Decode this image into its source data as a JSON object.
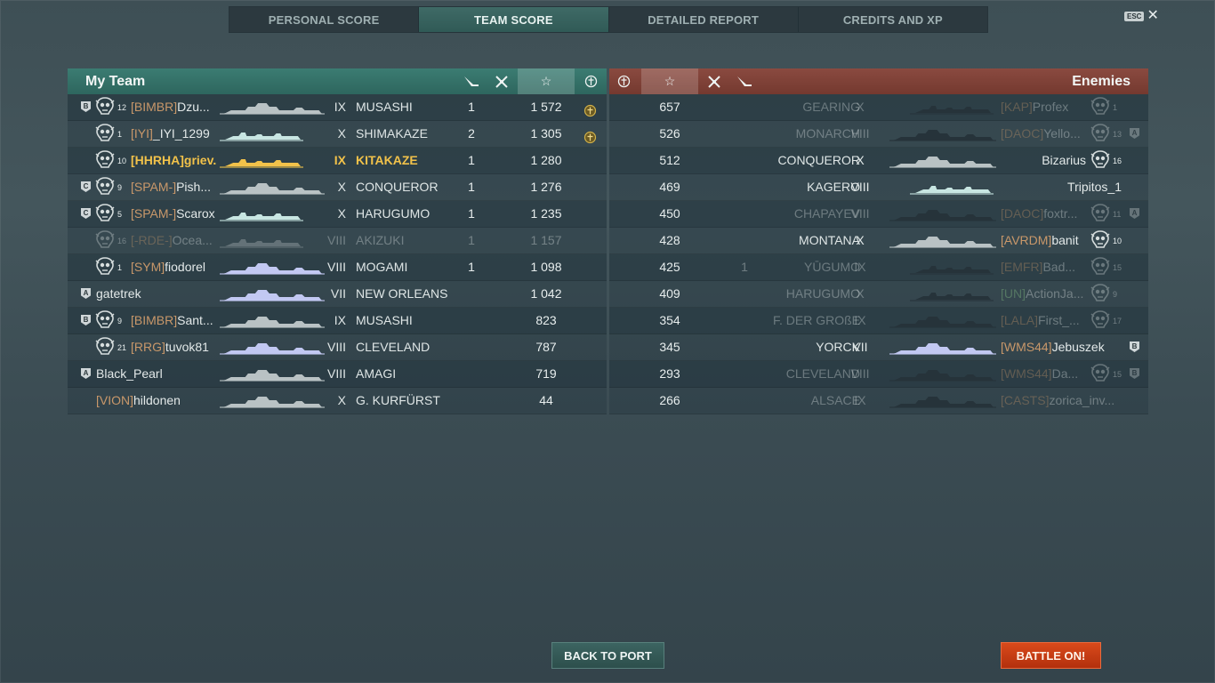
{
  "tabs": [
    "PERSONAL SCORE",
    "TEAM SCORE",
    "DETAILED REPORT",
    "CREDITS AND XP"
  ],
  "active_tab": 1,
  "esc": {
    "key_label": "ESC",
    "close_glyph": "✕"
  },
  "my_team": {
    "title": "My Team",
    "header_icons": [
      "torpedo-hit-icon",
      "plane-kill-icon",
      "star-score-icon",
      "medal-icon"
    ],
    "rows": [
      {
        "rank_badge": "B",
        "level": "12",
        "clan": "[BIMBR]",
        "player": "Dzu...",
        "tier": "IX",
        "ship": "MUSASHI",
        "kills": "1",
        "score": "1 572",
        "medal": true,
        "dead": false,
        "self": false
      },
      {
        "rank_badge": "",
        "level": "1",
        "clan": "[IYI]",
        "player": "_IYI_1299",
        "tier": "X",
        "ship": "SHIMAKAZE",
        "kills": "2",
        "score": "1 305",
        "medal": true,
        "dead": false,
        "self": false
      },
      {
        "rank_badge": "",
        "level": "10",
        "clan": "[HHRHA]",
        "player": "griev...",
        "tier": "IX",
        "ship": "KITAKAZE",
        "kills": "1",
        "score": "1 280",
        "medal": false,
        "dead": false,
        "self": true
      },
      {
        "rank_badge": "C",
        "level": "9",
        "clan": "[SPAM-]",
        "player": "Pish...",
        "tier": "X",
        "ship": "CONQUEROR",
        "kills": "1",
        "score": "1 276",
        "medal": false,
        "dead": false,
        "self": false
      },
      {
        "rank_badge": "C",
        "level": "5",
        "clan": "[SPAM-]",
        "player": "Scarox",
        "tier": "X",
        "ship": "HARUGUMO",
        "kills": "1",
        "score": "1 235",
        "medal": false,
        "dead": false,
        "self": false
      },
      {
        "rank_badge": "",
        "level": "16",
        "clan": "[-RDE-]",
        "player": "Ocea...",
        "tier": "VIII",
        "ship": "AKIZUKI",
        "kills": "1",
        "score": "1 157",
        "medal": false,
        "dead": true,
        "self": false
      },
      {
        "rank_badge": "",
        "level": "1",
        "clan": "[SYM]",
        "player": "fiodorel",
        "tier": "VIII",
        "ship": "MOGAMI",
        "kills": "1",
        "score": "1 098",
        "medal": false,
        "dead": false,
        "self": false
      },
      {
        "rank_badge": "A",
        "level": "",
        "clan": "",
        "player": "gatetrek",
        "tier": "VII",
        "ship": "NEW ORLEANS",
        "kills": "",
        "score": "1 042",
        "medal": false,
        "dead": false,
        "self": false
      },
      {
        "rank_badge": "B",
        "level": "9",
        "clan": "[BIMBR]",
        "player": "Sant...",
        "tier": "IX",
        "ship": "MUSASHI",
        "kills": "",
        "score": "823",
        "medal": false,
        "dead": false,
        "self": false
      },
      {
        "rank_badge": "",
        "level": "21",
        "clan": "[RRG]",
        "player": "tuvok81",
        "tier": "VIII",
        "ship": "CLEVELAND",
        "kills": "",
        "score": "787",
        "medal": false,
        "dead": false,
        "self": false
      },
      {
        "rank_badge": "A",
        "level": "",
        "clan": "",
        "player": "Black_Pearl",
        "tier": "VIII",
        "ship": "AMAGI",
        "kills": "",
        "score": "719",
        "medal": false,
        "dead": false,
        "self": false
      },
      {
        "rank_badge": "",
        "level": "",
        "clan": "[VION]",
        "player": "hildonen",
        "tier": "X",
        "ship": "G. KURFÜRST",
        "kills": "",
        "score": "44",
        "medal": false,
        "dead": false,
        "self": false
      }
    ]
  },
  "enemies": {
    "title": "Enemies",
    "header_icons": [
      "medal-icon",
      "star-score-icon",
      "plane-kill-icon",
      "torpedo-hit-icon"
    ],
    "rows": [
      {
        "score": "657",
        "kills": "",
        "ship": "GEARING",
        "tier": "X",
        "clan": "[KAP]",
        "player": "Profex",
        "level": "1",
        "rank_badge": "",
        "dead": true
      },
      {
        "score": "526",
        "kills": "",
        "ship": "MONARCH",
        "tier": "VIII",
        "clan": "[DAOC]",
        "player": "Yello...",
        "level": "13",
        "rank_badge": "A",
        "dead": true
      },
      {
        "score": "512",
        "kills": "",
        "ship": "CONQUEROR",
        "tier": "X",
        "clan": "",
        "player": "Bizarius",
        "level": "16",
        "rank_badge": "",
        "dead": false
      },
      {
        "score": "469",
        "kills": "",
        "ship": "KAGERO",
        "tier": "VIII",
        "clan": "",
        "player": "Tripitos_1",
        "level": "",
        "rank_badge": "",
        "dead": false
      },
      {
        "score": "450",
        "kills": "",
        "ship": "CHAPAYEV",
        "tier": "VIII",
        "clan": "[DAOC]",
        "player": "foxtr...",
        "level": "11",
        "rank_badge": "A",
        "dead": true
      },
      {
        "score": "428",
        "kills": "",
        "ship": "MONTANA",
        "tier": "X",
        "clan": "[AVRDM]",
        "player": "banit",
        "level": "10",
        "rank_badge": "",
        "dead": false
      },
      {
        "score": "425",
        "kills": "1",
        "ship": "YŪGUMO",
        "tier": "IX",
        "clan": "[EMFR]",
        "player": "Bad...",
        "level": "15",
        "rank_badge": "",
        "dead": true
      },
      {
        "score": "409",
        "kills": "",
        "ship": "HARUGUMO",
        "tier": "X",
        "clan": "[UN]",
        "player": "ActionJa...",
        "level": "9",
        "rank_badge": "",
        "dead": true,
        "clan_green": true
      },
      {
        "score": "354",
        "kills": "",
        "ship": "F. DER GROßE",
        "tier": "IX",
        "clan": "[LALA]",
        "player": "First_...",
        "level": "17",
        "rank_badge": "",
        "dead": true
      },
      {
        "score": "345",
        "kills": "",
        "ship": "YORCK",
        "tier": "VII",
        "clan": "[WMS44]",
        "player": "Jebuszek",
        "level": "",
        "rank_badge": "B",
        "dead": false
      },
      {
        "score": "293",
        "kills": "",
        "ship": "CLEVELAND",
        "tier": "VIII",
        "clan": "[WMS44]",
        "player": "Da...",
        "level": "15",
        "rank_badge": "B",
        "dead": true
      },
      {
        "score": "266",
        "kills": "",
        "ship": "ALSACE",
        "tier": "IX",
        "clan": "[CASTS]",
        "player": "zorica_inv...",
        "level": "",
        "rank_badge": "",
        "dead": true
      }
    ]
  },
  "buttons": {
    "back": "BACK TO PORT",
    "battle": "BATTLE ON!"
  }
}
